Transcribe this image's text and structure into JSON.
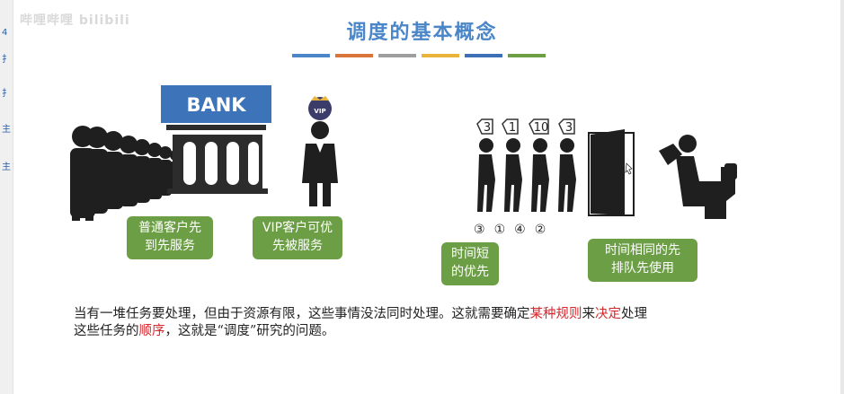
{
  "watermark": "哔哩哔哩 bilibili",
  "title": "调度的基本概念",
  "underline_colors": [
    "#4a86c8",
    "#d9743b",
    "#9e9e9e",
    "#e8b43a",
    "#3c6fb6",
    "#6c9f45"
  ],
  "bank_sign": "BANK",
  "vip_badge": "VIP",
  "callouts": {
    "normal": [
      "普通客户先",
      "到先服务"
    ],
    "vip": [
      "VIP客户可优",
      "先被服务"
    ],
    "short": [
      "时间短",
      "的优先"
    ],
    "same": [
      "时间相同的先",
      "排队先使用"
    ]
  },
  "queue_tags": [
    "3",
    "1",
    "10",
    "3"
  ],
  "queue_order": [
    "③",
    "①",
    "④",
    "②"
  ],
  "paragraph": {
    "p1": "当有一堆任务要处理，但由于资源有限，这些事情没法同时处理。这就需要确定",
    "r1": "某种规则",
    "p2": "来",
    "r2": "决定",
    "p3": "处理",
    "p4": "这些任务的",
    "r3": "顺序",
    "p5": "，这就是“调度”研究的问题。"
  },
  "colors": {
    "title": "#4a86c8",
    "callout": "#6c9f45",
    "highlight": "#d6262c",
    "bank": "#3d73b8"
  }
}
